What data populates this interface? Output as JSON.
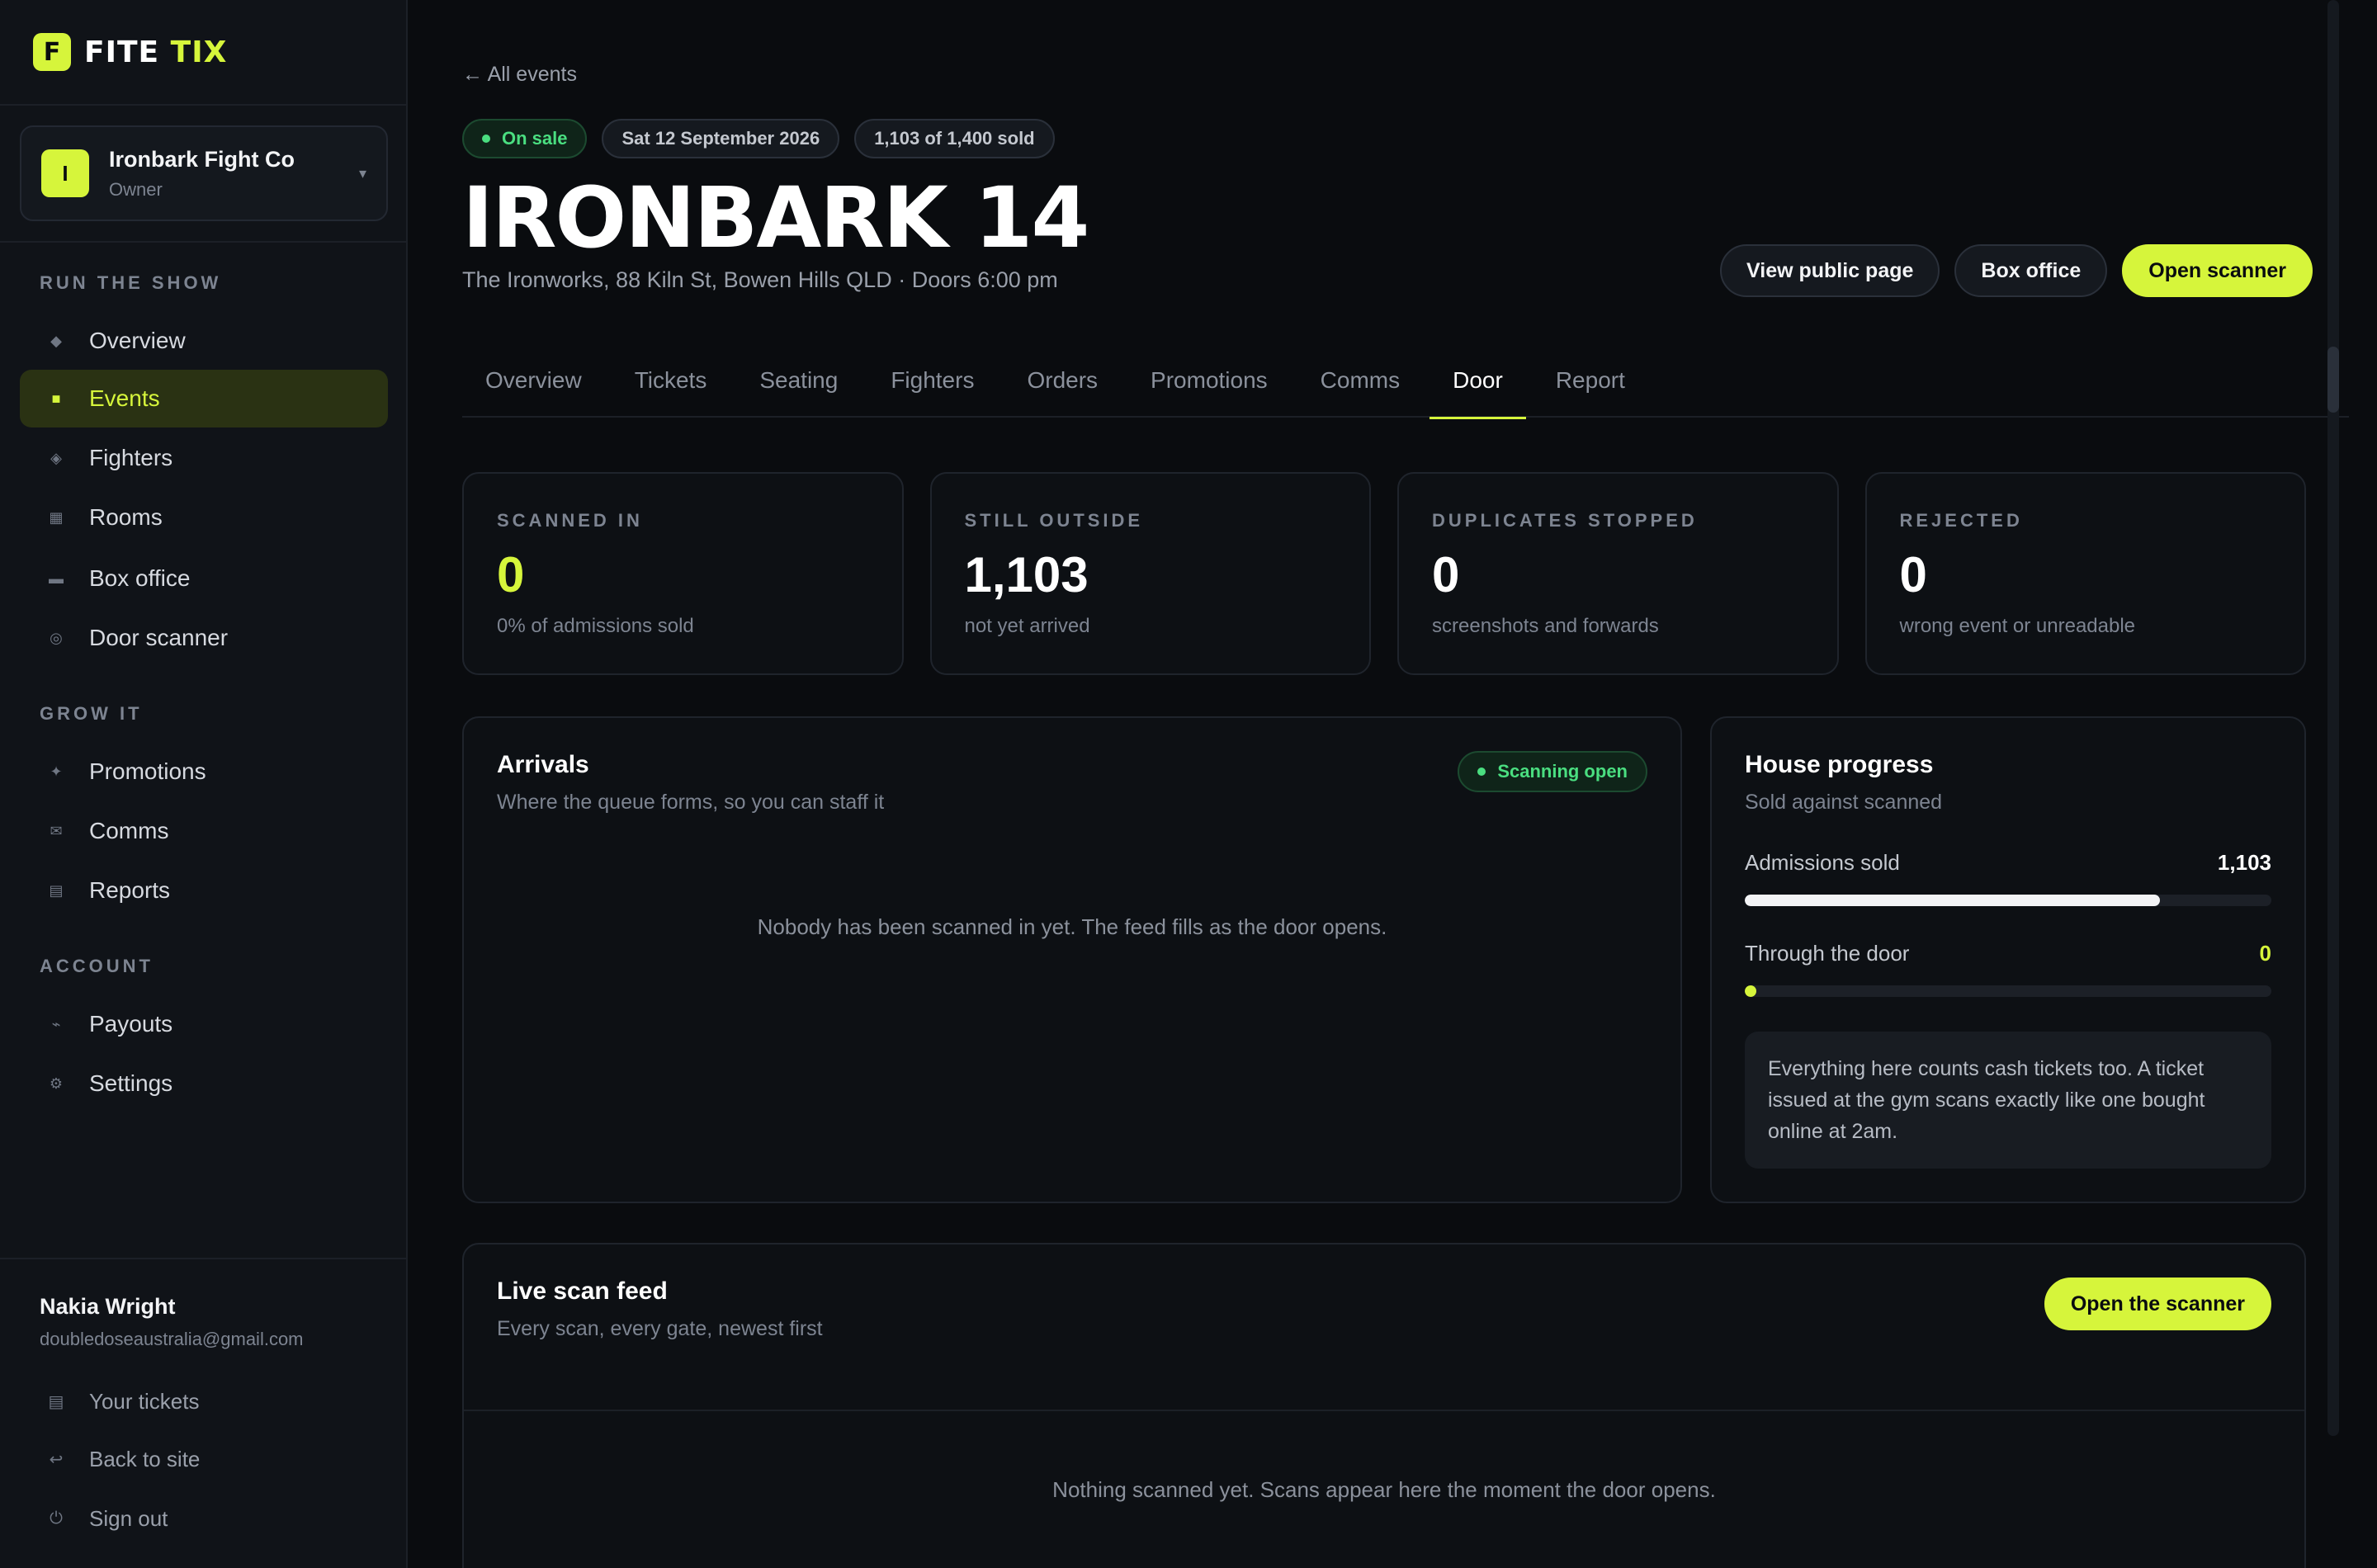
{
  "brand": {
    "mark": "F",
    "name_a": "FITE ",
    "name_b": "TIX"
  },
  "org": {
    "avatar": "I",
    "name": "Ironbark Fight Co",
    "role": "Owner"
  },
  "nav": {
    "section_run": "RUN THE SHOW",
    "section_grow": "GROW IT",
    "section_account": "ACCOUNT",
    "items": [
      {
        "label": "Overview",
        "icon": "diamond-icon"
      },
      {
        "label": "Events",
        "icon": "calendar-icon"
      },
      {
        "label": "Fighters",
        "icon": "fighter-icon"
      },
      {
        "label": "Rooms",
        "icon": "rooms-icon"
      },
      {
        "label": "Box office",
        "icon": "box-office-icon"
      },
      {
        "label": "Door scanner",
        "icon": "scanner-icon"
      },
      {
        "label": "Promotions",
        "icon": "sparkle-icon"
      },
      {
        "label": "Comms",
        "icon": "mail-icon"
      },
      {
        "label": "Reports",
        "icon": "reports-icon"
      },
      {
        "label": "Payouts",
        "icon": "payouts-icon"
      },
      {
        "label": "Settings",
        "icon": "gear-icon"
      }
    ]
  },
  "user": {
    "name": "Nakia Wright",
    "email": "doubledoseaustralia@gmail.com",
    "links": [
      "Your tickets",
      "Back to site",
      "Sign out"
    ]
  },
  "header": {
    "back": "← All events",
    "badge_status": "On sale",
    "badge_date": "Sat 12 September 2026",
    "badge_sold": "1,103 of 1,400 sold",
    "title": "IRONBARK 14",
    "subtitle": "The Ironworks, 88 Kiln St, Bowen Hills QLD · Doors 6:00 pm",
    "btn_public": "View public page",
    "btn_box": "Box office",
    "btn_scanner": "Open scanner"
  },
  "tabs": [
    "Overview",
    "Tickets",
    "Seating",
    "Fighters",
    "Orders",
    "Promotions",
    "Comms",
    "Door",
    "Report"
  ],
  "stats": [
    {
      "label": "SCANNED IN",
      "value": "0",
      "sub": "0% of admissions sold"
    },
    {
      "label": "STILL OUTSIDE",
      "value": "1,103",
      "sub": "not yet arrived"
    },
    {
      "label": "DUPLICATES STOPPED",
      "value": "0",
      "sub": "screenshots and forwards"
    },
    {
      "label": "REJECTED",
      "value": "0",
      "sub": "wrong event or unreadable"
    }
  ],
  "arrivals": {
    "title": "Arrivals",
    "sub": "Where the queue forms, so you can staff it",
    "badge": "Scanning open",
    "empty": "Nobody has been scanned in yet. The feed fills as the door opens."
  },
  "house": {
    "title": "House progress",
    "sub": "Sold against scanned",
    "sold_label": "Admissions sold",
    "sold_value": "1,103",
    "sold_fraction": 0.788,
    "door_label": "Through the door",
    "door_value": "0",
    "note": "Everything here counts cash tickets too. A ticket issued at the gym scans exactly like one bought online at 2am."
  },
  "feed": {
    "title": "Live scan feed",
    "sub": "Every scan, every gate, newest first",
    "btn": "Open the scanner",
    "empty": "Nothing scanned yet. Scans appear here the moment the door opens."
  },
  "colors": {
    "accent": "#d6f53b",
    "success": "#4ade80",
    "background": "#0a0c0f"
  }
}
